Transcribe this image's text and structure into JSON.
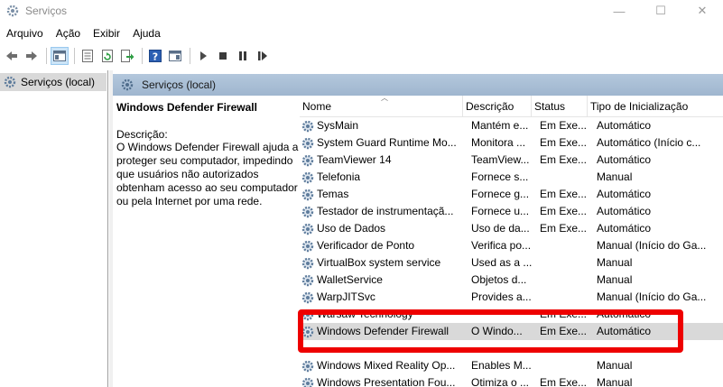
{
  "window": {
    "title": "Serviços",
    "controls": {
      "minimize": "—",
      "maximize": "☐",
      "close": "✕"
    }
  },
  "menu": [
    "Arquivo",
    "Ação",
    "Exibir",
    "Ajuda"
  ],
  "toolbar": {
    "icons": [
      "back-icon",
      "forward-icon",
      "show-hide-console-tree-icon",
      "properties-icon",
      "refresh-icon",
      "export-list-icon",
      "help-icon",
      "action-pane-icon",
      "start-icon",
      "stop-icon",
      "pause-icon",
      "restart-icon"
    ]
  },
  "tree": {
    "root_label": "Serviços (local)"
  },
  "panel": {
    "header_label": "Serviços (local)",
    "selected_service_title": "Windows Defender Firewall",
    "description_label": "Descrição:",
    "description_text": "O Windows Defender Firewall ajuda a proteger seu computador, impedindo que usuários não autorizados obtenham acesso ao seu computador ou pela Internet por uma rede."
  },
  "table": {
    "columns": [
      "Nome",
      "Descrição",
      "Status",
      "Tipo de Inicialização"
    ],
    "rows": [
      {
        "name": "SysMain",
        "desc": "Mantém e...",
        "status": "Em Exe...",
        "type": "Automático"
      },
      {
        "name": "System Guard Runtime Mo...",
        "desc": "Monitora ...",
        "status": "Em Exe...",
        "type": "Automático (Início c..."
      },
      {
        "name": "TeamViewer 14",
        "desc": "TeamView...",
        "status": "Em Exe...",
        "type": "Automático"
      },
      {
        "name": "Telefonia",
        "desc": "Fornece s...",
        "status": "",
        "type": "Manual"
      },
      {
        "name": "Temas",
        "desc": "Fornece g...",
        "status": "Em Exe...",
        "type": "Automático"
      },
      {
        "name": "Testador de instrumentaçã...",
        "desc": "Fornece u...",
        "status": "Em Exe...",
        "type": "Automático"
      },
      {
        "name": "Uso de Dados",
        "desc": "Uso de da...",
        "status": "Em Exe...",
        "type": "Automático"
      },
      {
        "name": "Verificador de Ponto",
        "desc": "Verifica po...",
        "status": "",
        "type": "Manual (Início do Ga..."
      },
      {
        "name": "VirtualBox system service",
        "desc": "Used as a ...",
        "status": "",
        "type": "Manual"
      },
      {
        "name": "WalletService",
        "desc": "Objetos d...",
        "status": "",
        "type": "Manual"
      },
      {
        "name": "WarpJITSvc",
        "desc": "Provides a...",
        "status": "",
        "type": "Manual (Início do Ga..."
      },
      {
        "name": "Warsaw Technology",
        "desc": "",
        "status": "Em Exe...",
        "type": "Automático"
      },
      {
        "name": "Windows Defender Firewall",
        "desc": "O Windo...",
        "status": "Em Exe...",
        "type": "Automático",
        "selected": true
      },
      {
        "name": "",
        "desc": "",
        "status": "",
        "type": ""
      },
      {
        "name": "Windows Mixed Reality Op...",
        "desc": "Enables M...",
        "status": "",
        "type": "Manual"
      },
      {
        "name": "Windows Presentation Fou...",
        "desc": "Otimiza o ...",
        "status": "Em Exe...",
        "type": "Manual"
      }
    ]
  },
  "colors": {
    "highlight": "#ee0000",
    "selected_row": "#d9d9d9",
    "panel_header": "#b3c7dc"
  }
}
